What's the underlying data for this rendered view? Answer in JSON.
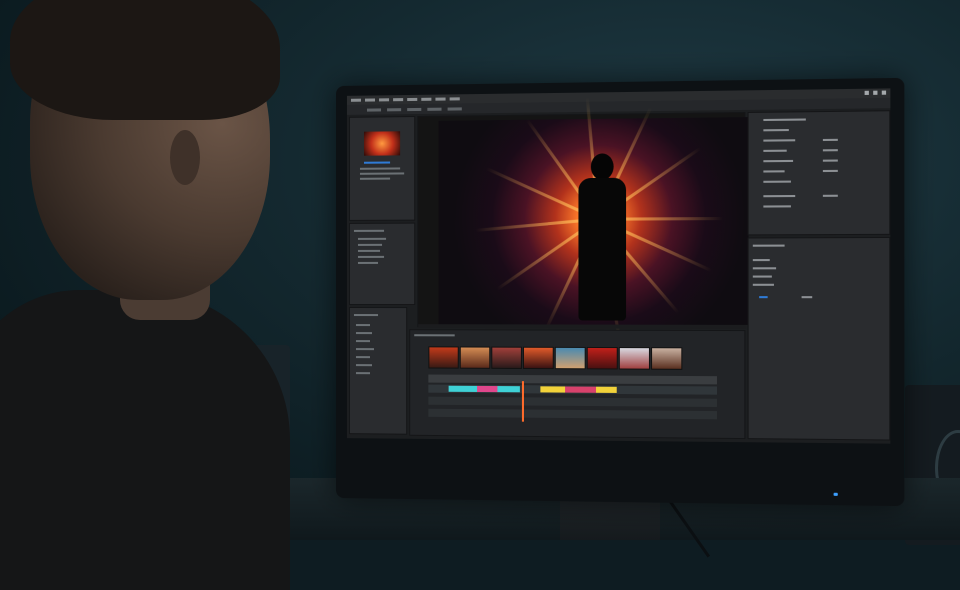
{
  "scene": {
    "description_free": true
  },
  "monitor": {
    "brand_text": "",
    "app": {
      "menu_items": 10,
      "viewer_dominant_colors": [
        "#ffd58a",
        "#ff7a2a",
        "#b2321c",
        "#4a1224"
      ],
      "timeline_segment_colors": [
        "#3fd1d6",
        "#e0478c",
        "#f2d23a",
        "#d8426c"
      ],
      "accent_color": "#2f7bd6",
      "playhead_color": "#ff6b2b"
    }
  }
}
